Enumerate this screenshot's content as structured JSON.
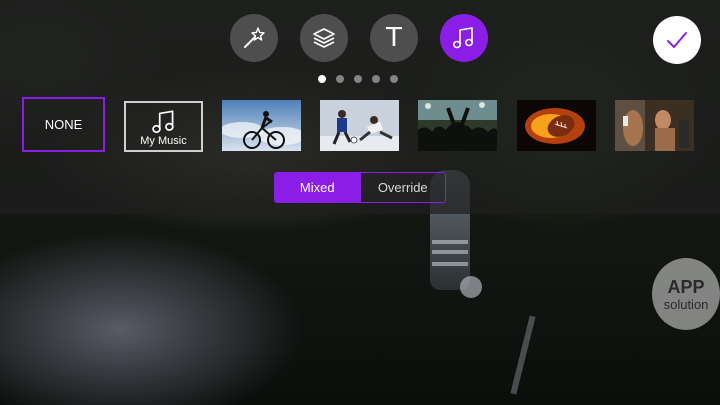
{
  "toolbar": {
    "icons": [
      {
        "name": "magic-wand-icon",
        "active": false
      },
      {
        "name": "layers-icon",
        "active": false
      },
      {
        "name": "text-icon",
        "glyph": "T",
        "active": false
      },
      {
        "name": "music-notes-icon",
        "active": true
      }
    ],
    "done_icon": "checkmark-icon"
  },
  "pager": {
    "count": 5,
    "current": 1
  },
  "music_options": [
    {
      "id": "none",
      "label": "NONE",
      "selected": true
    },
    {
      "id": "my-music",
      "label": "My Music",
      "icon": "music-notes-icon",
      "selected": false
    },
    {
      "id": "cycling",
      "thumbnail": "cyclist-photo",
      "selected": false
    },
    {
      "id": "soccer",
      "thumbnail": "soccer-players-photo",
      "selected": false
    },
    {
      "id": "concert",
      "thumbnail": "concert-crowd-photo",
      "selected": false
    },
    {
      "id": "football-fire",
      "thumbnail": "flaming-football-photo",
      "selected": false
    },
    {
      "id": "athlete",
      "thumbnail": "athlete-photo",
      "selected": false
    }
  ],
  "mix_mode": {
    "options": [
      "Mixed",
      "Override"
    ],
    "selected": "Mixed"
  },
  "watermark": {
    "line1": "APP",
    "line2": "solution"
  },
  "colors": {
    "accent": "#8a1ee6",
    "done_bg": "#ffffff"
  }
}
